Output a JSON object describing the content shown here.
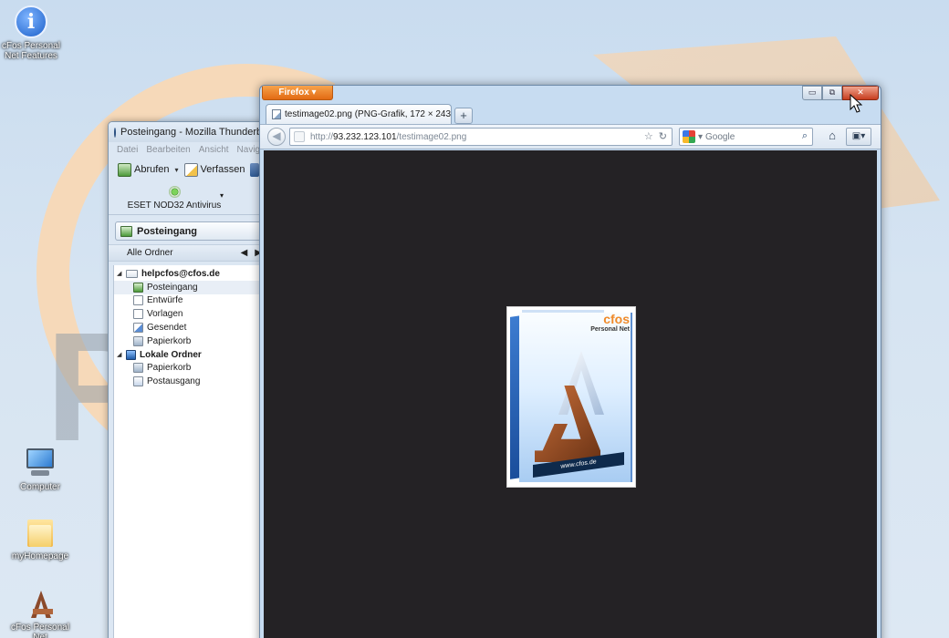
{
  "desktop": {
    "icons": [
      {
        "label": "cFos Personal Net Features"
      },
      {
        "label": "Computer"
      },
      {
        "label": "myHomepage"
      },
      {
        "label": "cFos Personal Net"
      }
    ]
  },
  "thunderbird": {
    "title": "Posteingang - Mozilla Thunderbird",
    "menu": [
      "Datei",
      "Bearbeiten",
      "Ansicht",
      "Navigation"
    ],
    "toolbar": {
      "get_mail": "Abrufen",
      "write": "Verfassen"
    },
    "addon": {
      "label": "ESET NOD32 Antivirus"
    },
    "folder_button": "Posteingang",
    "folder_pane_header": "Alle Ordner",
    "nav": {
      "prev": "◀",
      "next": "▶"
    },
    "tree": [
      {
        "label": "helpcfos@cfos.de",
        "level": 0,
        "icon": "account-icon"
      },
      {
        "label": "Posteingang",
        "level": 1,
        "icon": "inbox-icon",
        "selected": true
      },
      {
        "label": "Entwürfe",
        "level": 1,
        "icon": "drafts-icon"
      },
      {
        "label": "Vorlagen",
        "level": 1,
        "icon": "templates-icon"
      },
      {
        "label": "Gesendet",
        "level": 1,
        "icon": "sent-icon"
      },
      {
        "label": "Papierkorb",
        "level": 1,
        "icon": "trash-icon"
      },
      {
        "label": "Lokale Ordner",
        "level": 0,
        "icon": "local-folders-icon"
      },
      {
        "label": "Papierkorb",
        "level": 1,
        "icon": "trash-icon"
      },
      {
        "label": "Postausgang",
        "level": 1,
        "icon": "outbox-icon"
      }
    ]
  },
  "firefox": {
    "app_button": "Firefox ▾",
    "window_buttons": {
      "minimize": "▭",
      "restore": "⧉",
      "close": "✕"
    },
    "tab": {
      "title": "testimage02.png (PNG-Grafik, 172 × 243 ..."
    },
    "new_tab": "+",
    "urlbar": {
      "scheme": "http://",
      "host": "93.232.123.101",
      "path": "/testimage02.png",
      "star": "☆",
      "reload": "↻"
    },
    "search": {
      "placeholder": "Google",
      "engine_icon": "google-icon"
    },
    "image": {
      "brand": "cfos",
      "product": "Personal Net",
      "footer": "www.cfos.de"
    }
  },
  "colors": {
    "firefox_orange": "#e26a13",
    "content_bg": "#242225",
    "close_red": "#c73d1f",
    "cfos_orange": "#f08a2a"
  }
}
